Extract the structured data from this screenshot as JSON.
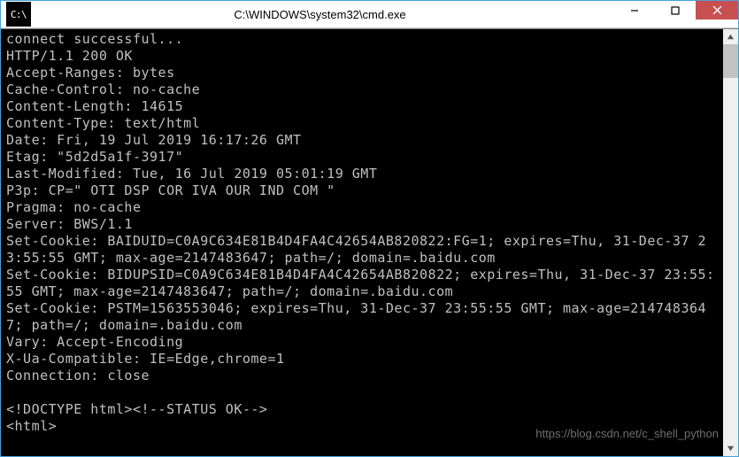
{
  "window": {
    "title": "C:\\WINDOWS\\system32\\cmd.exe",
    "icon_label": "C:\\"
  },
  "terminal": {
    "lines": [
      "connect successful...",
      "HTTP/1.1 200 OK",
      "Accept-Ranges: bytes",
      "Cache-Control: no-cache",
      "Content-Length: 14615",
      "Content-Type: text/html",
      "Date: Fri, 19 Jul 2019 16:17:26 GMT",
      "Etag: \"5d2d5a1f-3917\"",
      "Last-Modified: Tue, 16 Jul 2019 05:01:19 GMT",
      "P3p: CP=\" OTI DSP COR IVA OUR IND COM \"",
      "Pragma: no-cache",
      "Server: BWS/1.1",
      "Set-Cookie: BAIDUID=C0A9C634E81B4D4FA4C42654AB820822:FG=1; expires=Thu, 31-Dec-37 23:55:55 GMT; max-age=2147483647; path=/; domain=.baidu.com",
      "Set-Cookie: BIDUPSID=C0A9C634E81B4D4FA4C42654AB820822; expires=Thu, 31-Dec-37 23:55:55 GMT; max-age=2147483647; path=/; domain=.baidu.com",
      "Set-Cookie: PSTM=1563553046; expires=Thu, 31-Dec-37 23:55:55 GMT; max-age=2147483647; path=/; domain=.baidu.com",
      "Vary: Accept-Encoding",
      "X-Ua-Compatible: IE=Edge,chrome=1",
      "Connection: close",
      "",
      "<!DOCTYPE html><!--STATUS OK-->",
      "<html>"
    ]
  },
  "watermark": "https://blog.csdn.net/c_shell_python"
}
